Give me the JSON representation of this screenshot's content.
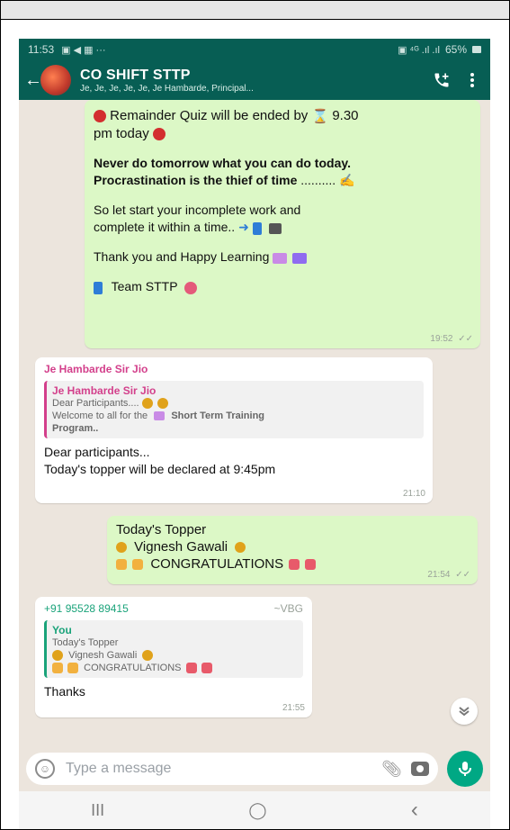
{
  "status": {
    "time": "11:53",
    "left_icons": "▣ ◀ ▦ ···",
    "right_icons": "▣ ⁴ᴳ .ıl .ıl",
    "battery": "65%"
  },
  "header": {
    "title": "CO SHIFT STTP",
    "subtitle": "Je, Je, Je, Je, Je, Je Hambarde, Principal..."
  },
  "messages": {
    "m1": {
      "l1": "Remainder Quiz will be ended by",
      "l1b": "9.30",
      "l2": "pm today",
      "p2l1": "Never do tomorrow what you can do today.",
      "p2l2": "Procrastination is the thief of time",
      "p2l2b": "..........",
      "p3l1": "So let start your incomplete work and",
      "p3l2": "complete it within a time..",
      "p4": "Thank you and Happy Learning",
      "p5": "Team STTP",
      "time": "19:52"
    },
    "m2": {
      "sender": "Je Hambarde Sir Jio",
      "quote_sender": "Je Hambarde Sir Jio",
      "quote_l1": "Dear Participants....",
      "quote_l2": "Welcome to all for the",
      "quote_l2b": "Short Term Training",
      "quote_l3": "Program..",
      "body_l1": "Dear participants...",
      "body_l2": "Today's topper will be declared at 9:45pm",
      "time": "21:10"
    },
    "m3": {
      "l1": "Today's Topper",
      "l2": "Vignesh Gawali",
      "l3": "CONGRATULATIONS",
      "time": "21:54"
    },
    "m4": {
      "sender_number": "+91 95528 89415",
      "sender_tag": "~VBG",
      "quote_sender": "You",
      "quote_l1": "Today's Topper",
      "quote_l2": "Vignesh Gawali",
      "quote_l3": "CONGRATULATIONS",
      "body": "Thanks",
      "time": "21:55"
    }
  },
  "composer": {
    "placeholder": "Type a message"
  },
  "nav": {
    "recent": "III",
    "home": "◯",
    "back": "‹"
  },
  "colors": {
    "header": "#075e54",
    "outgoing_bubble": "#dcf8c6",
    "incoming_bubble": "#ffffff",
    "accent": "#00a884",
    "chat_bg": "#ece5dd",
    "sender_name": "#d33f8b",
    "sender_number": "#1aa37a"
  },
  "icons": [
    "back-arrow-icon",
    "group-avatar",
    "add-call-icon",
    "more-vert-icon",
    "emoji-icon",
    "attach-icon",
    "camera-icon",
    "mic-icon",
    "scroll-down-icon"
  ]
}
